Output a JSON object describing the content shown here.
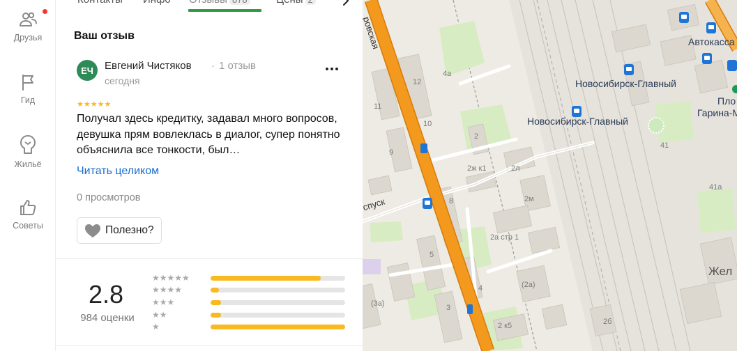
{
  "nav": {
    "items": [
      {
        "label": "Друзья",
        "icon": "friends-icon"
      },
      {
        "label": "Гид",
        "icon": "flag-icon"
      },
      {
        "label": "Жильё",
        "icon": "housing-icon"
      },
      {
        "label": "Советы",
        "icon": "thumb-up-icon"
      }
    ]
  },
  "tabs": {
    "items": [
      {
        "label": "Контакты"
      },
      {
        "label": "Инфо"
      },
      {
        "label": "Отзывы",
        "badge": "878"
      },
      {
        "label": "Цены",
        "badge": "2"
      }
    ],
    "active_index": 2
  },
  "review": {
    "section_title": "Ваш отзыв",
    "avatar_initials": "ЕЧ",
    "author": "Евгений Чистяков",
    "separator": "·",
    "author_reviews": "1 отзыв",
    "date": "сегодня",
    "stars": 5,
    "stars_text": "★★★★★",
    "text": "Получал здесь кредитку, задавал много вопросов, девушка прям вовлеклась в диалог, супер понятно объяснила все тонкости, был…",
    "read_more": "Читать целиком",
    "views": "0 просмотров",
    "useful_label": "Полезно?"
  },
  "rating": {
    "value": "2.8",
    "count_label": "984 оценки",
    "distribution": [
      {
        "stars": 5,
        "stars_text": "★★★★★",
        "fraction": 0.82
      },
      {
        "stars": 4,
        "stars_text": "★★★★",
        "fraction": 0.06
      },
      {
        "stars": 3,
        "stars_text": "★★★",
        "fraction": 0.08
      },
      {
        "stars": 2,
        "stars_text": "★★",
        "fraction": 0.08
      },
      {
        "stars": 1,
        "stars_text": "★",
        "fraction": 1.0
      }
    ]
  },
  "map": {
    "labels": {
      "street_vertical": "ровская",
      "street_spusk": "спуск",
      "station1": "Новосибирск-Главный",
      "station2": "Новосибирск-Главный",
      "autokassa": "Автокасса",
      "plo": "Пло",
      "garina": "Гарина-Ми",
      "zhel": "Жел",
      "b4a": "4а",
      "b12": "12",
      "b11": "11",
      "b10": "10",
      "b9": "9",
      "b2": "2",
      "b2zhk1": "2ж к1",
      "b2l": "2л",
      "b2m": "2м",
      "b8": "8",
      "b2astr1": "2а стр 1",
      "b5": "5",
      "b4": "4",
      "b2a": "(2а)",
      "b3a": "(3а)",
      "b3": "3",
      "b2k5": "2 к5",
      "b2b": "2б",
      "b41": "41",
      "b41a": "41а"
    }
  },
  "colors": {
    "accent_green": "#2e9c43",
    "link_blue": "#1a6dce",
    "star_yellow": "#f9b920",
    "road_orange": "#f08f14",
    "notify_red": "#ff3333"
  }
}
